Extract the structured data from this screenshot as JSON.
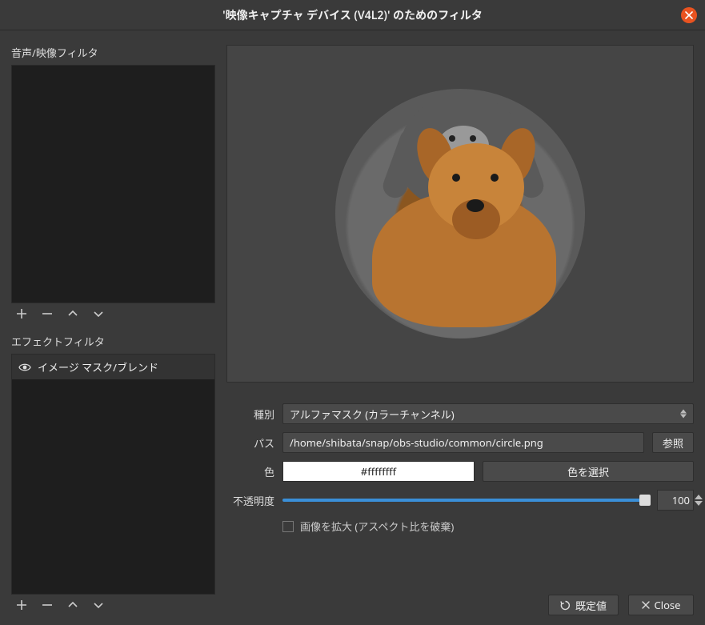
{
  "window": {
    "title": "'映像キャプチャ デバイス (V4L2)' のためのフィルタ"
  },
  "left": {
    "audio_label": "音声/映像フィルタ",
    "effect_label": "エフェクトフィルタ",
    "effect_items": [
      {
        "name": "イメージ マスク/ブレンド"
      }
    ]
  },
  "props": {
    "type_label": "種別",
    "type_value": "アルファマスク (カラーチャンネル)",
    "path_label": "パス",
    "path_value": "/home/shibata/snap/obs-studio/common/circle.png",
    "browse_label": "参照",
    "color_label": "色",
    "color_hex": "#ffffffff",
    "pick_color_label": "色を選択",
    "opacity_label": "不透明度",
    "opacity_value": "100",
    "stretch_label": "画像を拡大 (アスペクト比を破棄)"
  },
  "footer": {
    "defaults_label": "既定値",
    "close_label": "Close"
  }
}
